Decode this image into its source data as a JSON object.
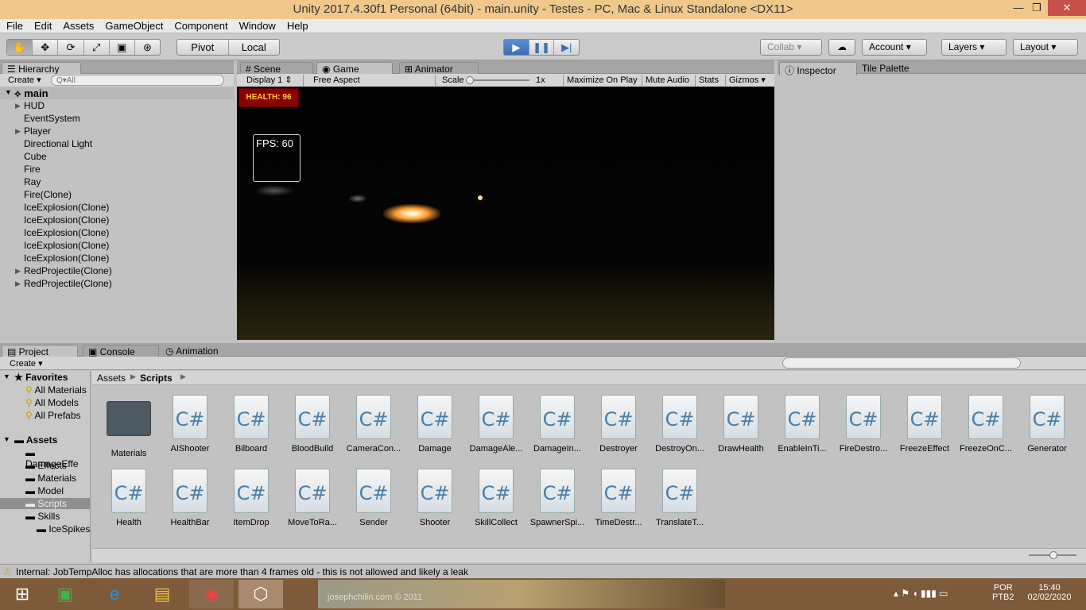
{
  "window": {
    "title": "Unity 2017.4.30f1 Personal (64bit) - main.unity - Testes - PC, Mac & Linux Standalone <DX11>",
    "minimize": "—",
    "maximize": "❐",
    "close": "✕"
  },
  "menu": [
    "File",
    "Edit",
    "Assets",
    "GameObject",
    "Component",
    "Window",
    "Help"
  ],
  "toolbar": {
    "pivot": "Pivot",
    "local": "Local",
    "collab": "Collab",
    "account": "Account",
    "layers": "Layers",
    "layout": "Layout",
    "play": "▶",
    "pause": "❚❚",
    "step": "▶|"
  },
  "hierarchy": {
    "tab": "Hierarchy",
    "create": "Create",
    "search_placeholder": "Q▾All",
    "scene": "main",
    "items": [
      {
        "label": "HUD",
        "arrow": "▶"
      },
      {
        "label": "EventSystem"
      },
      {
        "label": "Player",
        "arrow": "▶"
      },
      {
        "label": "Directional Light"
      },
      {
        "label": "Cube"
      },
      {
        "label": "Fire"
      },
      {
        "label": "Ray"
      },
      {
        "label": "Fire(Clone)"
      },
      {
        "label": "IceExplosion(Clone)"
      },
      {
        "label": "IceExplosion(Clone)"
      },
      {
        "label": "IceExplosion(Clone)"
      },
      {
        "label": "IceExplosion(Clone)"
      },
      {
        "label": "IceExplosion(Clone)"
      },
      {
        "label": "RedProjectile(Clone)",
        "arrow": "▶"
      },
      {
        "label": "RedProjectile(Clone)",
        "arrow": "▶"
      }
    ]
  },
  "center_tabs": {
    "scene": "Scene",
    "game": "Game",
    "animator": "Animator"
  },
  "game": {
    "display": "Display 1",
    "aspect": "Free Aspect",
    "scale_label": "Scale",
    "scale_value": "1x",
    "maximize": "Maximize On Play",
    "mute": "Mute Audio",
    "stats": "Stats",
    "gizmos": "Gizmos",
    "health": "HEALTH: 96",
    "fps": "FPS: 60"
  },
  "inspector": {
    "tab": "Inspector",
    "tile_palette": "Tile Palette"
  },
  "bottom_tabs": {
    "project": "Project",
    "console": "Console",
    "animation": "Animation"
  },
  "project": {
    "create": "Create",
    "favorites": "Favorites",
    "fav_items": [
      "All Materials",
      "All Models",
      "All Prefabs"
    ],
    "assets": "Assets",
    "folders": [
      "DamageEffe",
      "Effects",
      "Materials",
      "Model",
      "Scripts",
      "Skills"
    ],
    "subfolder": "IceSpikes",
    "breadcrumb": [
      "Assets",
      "Scripts"
    ],
    "files": [
      {
        "label": "Materials",
        "folder": true
      },
      {
        "label": "AIShooter"
      },
      {
        "label": "Bilboard"
      },
      {
        "label": "BloodBuild"
      },
      {
        "label": "CameraCon..."
      },
      {
        "label": "Damage"
      },
      {
        "label": "DamageAle..."
      },
      {
        "label": "DamageIn..."
      },
      {
        "label": "Destroyer"
      },
      {
        "label": "DestroyOn..."
      },
      {
        "label": "DrawHealth"
      },
      {
        "label": "EnableInTi..."
      },
      {
        "label": "FireDestro..."
      },
      {
        "label": "FreezeEffect"
      },
      {
        "label": "FreezeOnC..."
      },
      {
        "label": "Generator"
      },
      {
        "label": "Health"
      },
      {
        "label": "HealthBar"
      },
      {
        "label": "ItemDrop"
      },
      {
        "label": "MoveToRa..."
      },
      {
        "label": "Sender"
      },
      {
        "label": "Shooter"
      },
      {
        "label": "SkillCollect"
      },
      {
        "label": "SpawnerSpi..."
      },
      {
        "label": "TimeDestr..."
      },
      {
        "label": "TranslateT..."
      }
    ]
  },
  "status": "Internal: JobTempAlloc has allocations that are more than 4 frames old - this is not allowed and likely a leak",
  "taskbar": {
    "wallpaper_text": "josephchilin.com © 2011",
    "lang1": "POR",
    "lang2": "PTB2",
    "time": "15:40",
    "date": "02/02/2020"
  },
  "colors": {
    "title_bg": "#f0c88c",
    "play_blue": "#3e6fb3",
    "health_bg": "#8b0000"
  }
}
